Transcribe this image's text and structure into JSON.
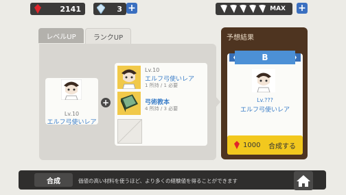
{
  "top_bar": {
    "red_gem_count": "2141",
    "crystal_count": "3",
    "plus_label": "+",
    "stamina_label": "MAX"
  },
  "tabs": [
    {
      "label": "レベルUP"
    },
    {
      "label": "ランクUP"
    }
  ],
  "base_unit": {
    "level": "Lv.10",
    "name": "エルフ弓使いレア"
  },
  "materials": [
    {
      "level": "Lv.10",
      "name": "エルフ弓使いレア",
      "stock": "1 所持 / 1 必要"
    },
    {
      "name": "弓術教本",
      "stock": "4 所持 / 3 必要"
    }
  ],
  "result": {
    "header": "予想結果",
    "rank": "B",
    "level": "Lv.???",
    "name": "エルフ弓使いレア",
    "cost": "1000",
    "button_label": "合成する"
  },
  "bottom": {
    "title": "合成",
    "hint": "価値の高い材料を使うほど、より多くの経験値を得ることができます"
  },
  "colors": {
    "accent_blue": "#3a7dc8",
    "result_bg": "#4e3420",
    "button_yellow": "#f2c81e"
  }
}
